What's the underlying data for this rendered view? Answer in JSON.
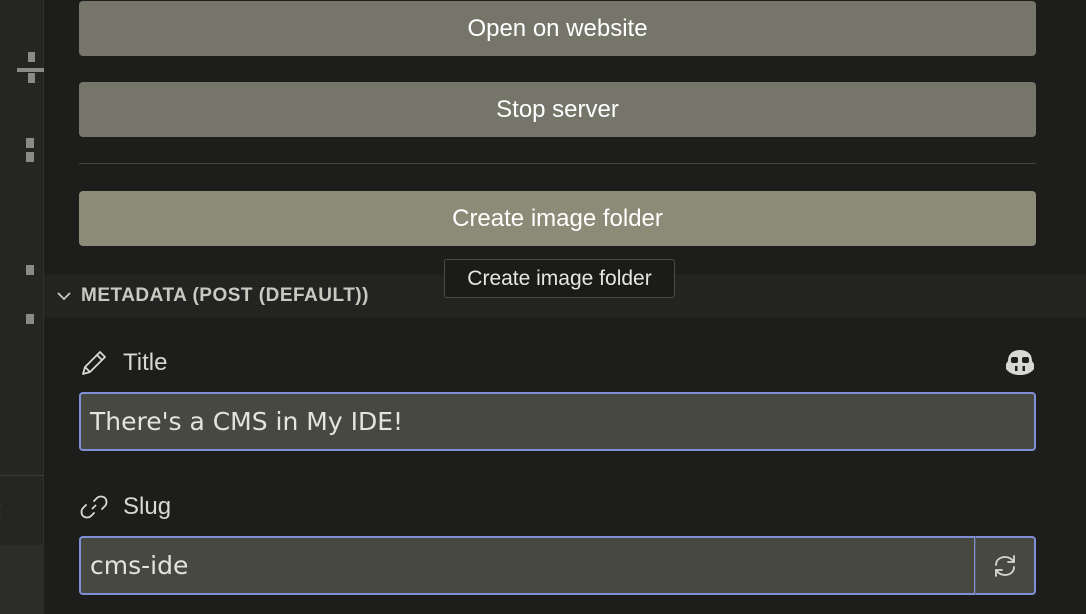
{
  "buttons": {
    "open_website": "Open on website",
    "stop_server": "Stop server",
    "create_image_folder": "Create image folder"
  },
  "tooltip": "Create image folder",
  "metadata": {
    "header": "METADATA (POST (DEFAULT))",
    "title_label": "Title",
    "title_value": "There's a CMS in My IDE!",
    "slug_label": "Slug",
    "slug_value": "cms-ide"
  },
  "colors": {
    "accent_border": "#7f8fd6",
    "button_bg": "#76756a",
    "button_bg_hover": "#8c8b78"
  },
  "icons": [
    "chevron-down-icon",
    "pencil-icon",
    "copilot-icon",
    "link-icon",
    "refresh-icon",
    "chevron-left-icon"
  ]
}
